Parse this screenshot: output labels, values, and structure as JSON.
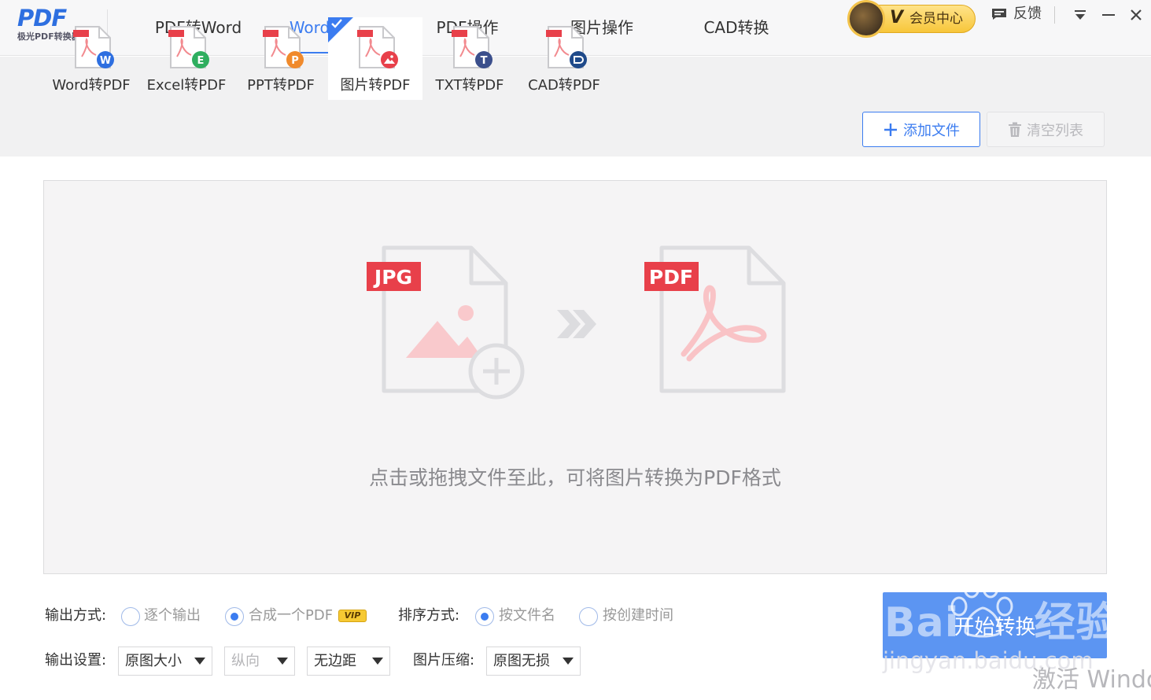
{
  "app": {
    "logo_text": "PDF",
    "logo_subtitle": "极光PDF转换器"
  },
  "nav": {
    "tabs": [
      {
        "label": "PDF转Word"
      },
      {
        "label": "Word转PDF"
      },
      {
        "label": "PDF操作"
      },
      {
        "label": "图片操作"
      },
      {
        "label": "CAD转换"
      }
    ],
    "active_index": 1
  },
  "header": {
    "vip_letter": "V",
    "vip_label": "会员中心",
    "feedback_label": "反馈"
  },
  "tools": [
    {
      "label": "Word转PDF",
      "badge_letter": "W",
      "badge_color": "#2e6fe0"
    },
    {
      "label": "Excel转PDF",
      "badge_letter": "E",
      "badge_color": "#2fae5f"
    },
    {
      "label": "PPT转PDF",
      "badge_letter": "P",
      "badge_color": "#f08a2c"
    },
    {
      "label": "图片转PDF",
      "badge_letter": "",
      "badge_color": "#e8404a"
    },
    {
      "label": "TXT转PDF",
      "badge_letter": "T",
      "badge_color": "#3b4f8c"
    },
    {
      "label": "CAD转PDF",
      "badge_letter": "",
      "badge_color": "#1f4a8a"
    }
  ],
  "tools_active_index": 3,
  "actions": {
    "add_file": "添加文件",
    "clear_list": "清空列表"
  },
  "dropzone": {
    "source_tag": "JPG",
    "target_tag": "PDF",
    "hint": "点击或拖拽文件至此，可将图片转换为PDF格式"
  },
  "options": {
    "output_mode_label": "输出方式:",
    "output_mode_options": [
      {
        "label": "逐个输出",
        "selected": false
      },
      {
        "label": "合成一个PDF",
        "selected": true
      }
    ],
    "vip_badge": "VIP",
    "sort_label": "排序方式:",
    "sort_options": [
      {
        "label": "按文件名",
        "selected": true
      },
      {
        "label": "按创建时间",
        "selected": false
      }
    ],
    "output_settings_label": "输出设置:",
    "page_size": "原图大小",
    "orientation": "纵向",
    "margin": "无边距",
    "compress_label": "图片压缩:",
    "compress_value": "原图无损"
  },
  "start_button": "开始转换",
  "watermark": {
    "brand": "Bai",
    "brand_suffix": "经验",
    "url": "jingyan.baidu.com",
    "activate": "激活 Windo"
  },
  "colors": {
    "accent": "#3b7cf0",
    "start_button": "#5c95f2",
    "file_tag_red": "#e8404a"
  }
}
